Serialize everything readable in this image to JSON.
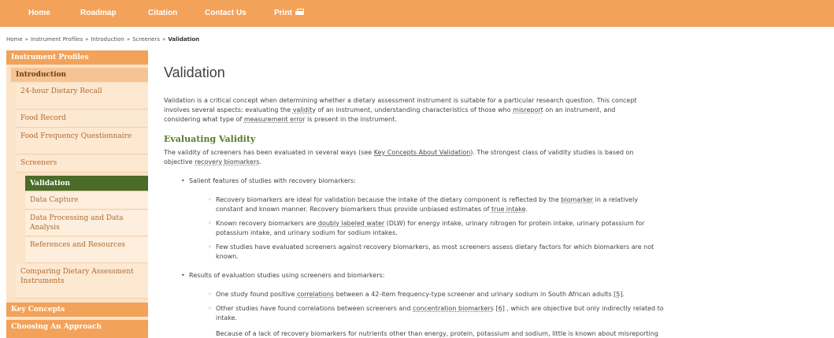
{
  "nav": {
    "home": "Home",
    "roadmap": "Roadmap",
    "citation": "Citation",
    "contact": "Contact Us",
    "print": "Print"
  },
  "breadcrumb": {
    "items": [
      "Home",
      "Instrument Profiles",
      "Introduction",
      "Screeners"
    ],
    "current": "Validation",
    "separator": "»"
  },
  "sidebar": {
    "instrument_profiles": "Instrument Profiles",
    "introduction": "Introduction",
    "recall": "24-hour Dietary Recall",
    "food_record": "Food Record",
    "ffq": "Food Frequency Questionnaire",
    "screeners": "Screeners",
    "validation": "Validation",
    "data_capture": "Data Capture",
    "data_processing": "Data Processing and Data Analysis",
    "references": "References and Resources",
    "comparing": "Comparing Dietary Assessment Instruments",
    "key_concepts": "Key Concepts",
    "choosing": "Choosing An Approach"
  },
  "main": {
    "title": "Validation",
    "intro_1": "Validation is a critical concept when determining whether a dietary assessment instrument is suitable for a particular research question. This concept",
    "intro_2a": "involves several aspects: evaluating the ",
    "intro_2b": "validity",
    "intro_2c": " of an instrument, understanding characteristics of those who ",
    "intro_2d": "misreport",
    "intro_2e": " on an instrument, and",
    "intro_3a": "considering what type of ",
    "intro_3b": "measurement error",
    "intro_3c": " is present in the instrument.",
    "h_eval": "Evaluating Validity",
    "eval_1a": "The validity of screeners has been evaluated in several ways (see ",
    "eval_1b": "Key Concepts About Validation",
    "eval_1c": "). The strongest class of validity studies is based on",
    "eval_2a": "objective ",
    "eval_2b": "recovery biomarkers",
    "eval_2c": ".",
    "bullet1": "Salient features of studies with recovery biomarkers:",
    "s1_1a": "Recovery biomarkers are ideal for validation because the intake of the dietary component is reflected by the ",
    "s1_1b": "biomarker",
    "s1_1c": " in a relatively",
    "s1_2a": "constant and known manner. Recovery biomarkers thus provide unbiased estimates of ",
    "s1_2b": "true intake",
    "s1_2c": ".",
    "s2_1a": "Known recovery biomarkers are ",
    "s2_1b": "doubly labeled water",
    "s2_1c": " (DLW) for energy intake, urinary nitrogen for protein intake, urinary potassium for",
    "s2_2": "potassium intake, and urinary sodium for sodium intakes.",
    "s3_1": "Few studies have evaluated screeners against recovery biomarkers, as most screeners assess dietary factors for which biomarkers are not",
    "s3_2": "known.",
    "bullet2": "Results of evaluation studies using screeners and biomarkers:",
    "r1a": "One study found positive ",
    "r1b": "correlations",
    "r1c": " between a 42-item frequency-type screener and urinary sodium in South African adults ",
    "r1d": "[5]",
    "r1e": ".",
    "r2a": "Other studies have found correlations between screeners and ",
    "r2b": "concentration biomarkers",
    "r2c": " ",
    "r2d": "[6]",
    "r2e": " , which are objective but only indirectly related to",
    "r2f": "intake.",
    "r3": "Because of a lack of recovery biomarkers for nutrients other than energy, protein, potassium and sodium, little is known about misreporting"
  },
  "colors": {
    "nav_bg": "#f3a25a",
    "sidebar_bg": "#fbe3c8",
    "active_bg": "#4b6b2a",
    "heading_green": "#5a7a2a"
  },
  "icons": {
    "print": "printer-icon"
  }
}
